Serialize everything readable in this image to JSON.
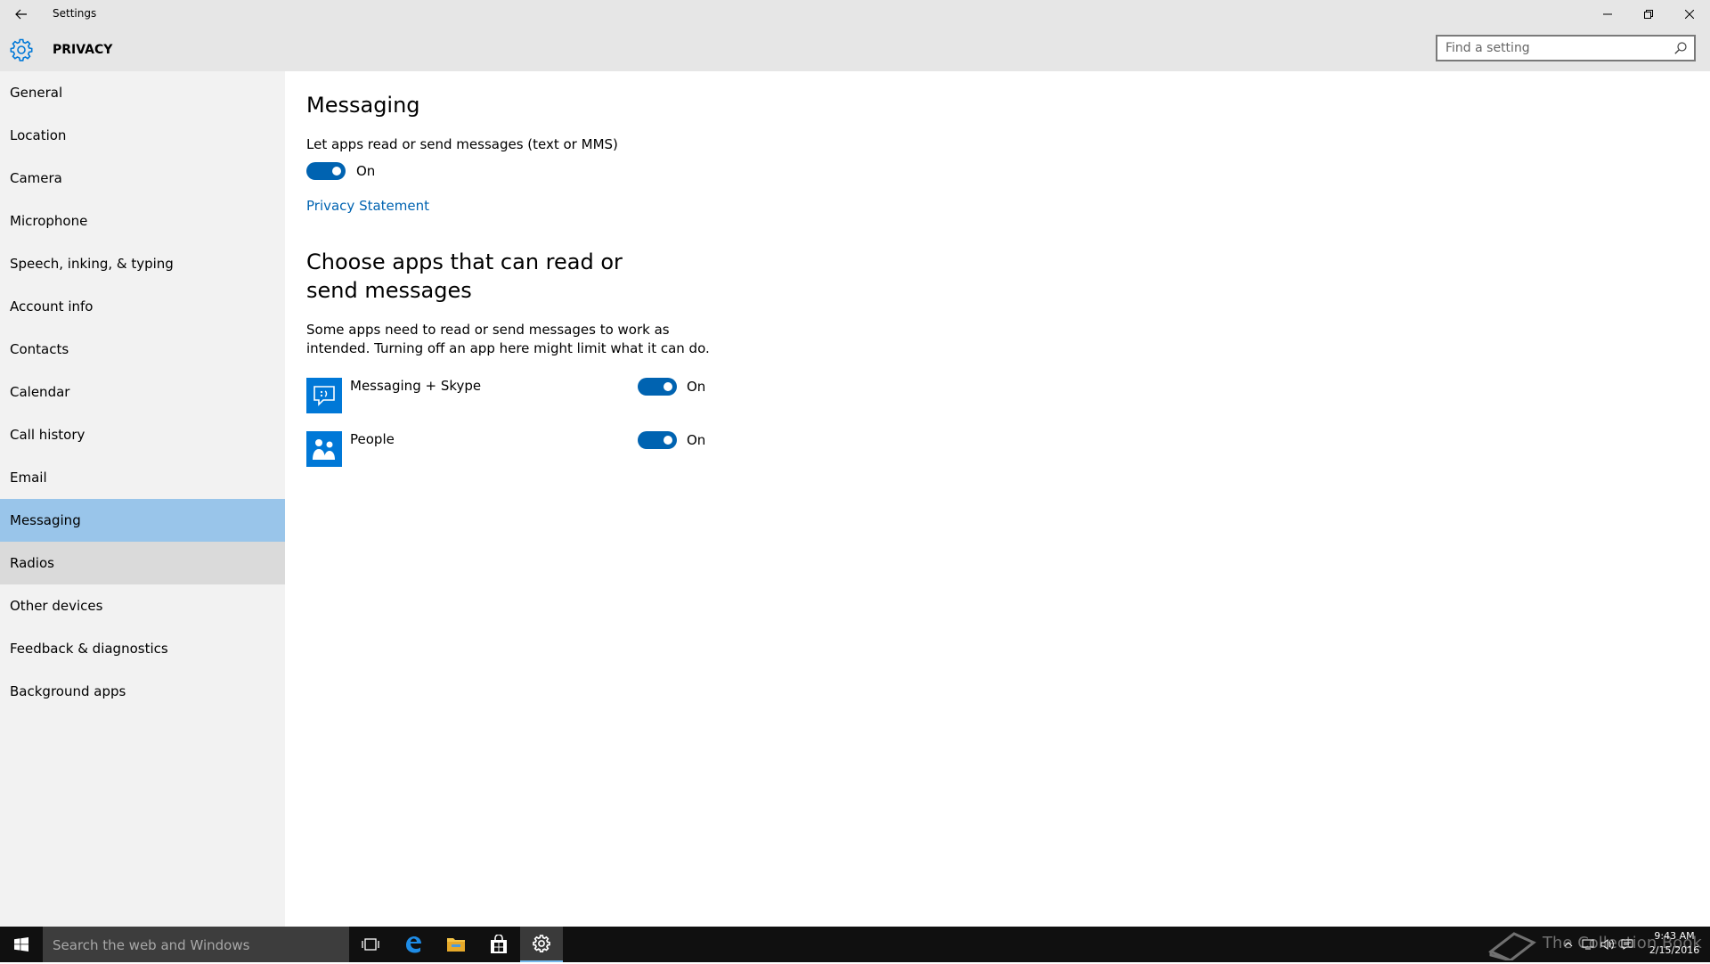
{
  "window": {
    "title": "Settings",
    "icons": {
      "back": "back-arrow-icon",
      "minimize": "minimize-icon",
      "restore": "restore-icon",
      "close": "close-icon"
    }
  },
  "header": {
    "section_title": "PRIVACY",
    "icon": "gear-icon",
    "search": {
      "placeholder": "Find a setting",
      "value": "",
      "icon": "search-icon"
    }
  },
  "sidebar": {
    "selected": "Messaging",
    "hovered": "Radios",
    "selected_color": "#99c5ea",
    "items": [
      {
        "label": "General"
      },
      {
        "label": "Location"
      },
      {
        "label": "Camera"
      },
      {
        "label": "Microphone"
      },
      {
        "label": "Speech, inking, & typing"
      },
      {
        "label": "Account info"
      },
      {
        "label": "Contacts"
      },
      {
        "label": "Calendar"
      },
      {
        "label": "Call history"
      },
      {
        "label": "Email"
      },
      {
        "label": "Messaging"
      },
      {
        "label": "Radios"
      },
      {
        "label": "Other devices"
      },
      {
        "label": "Feedback & diagnostics"
      },
      {
        "label": "Background apps"
      }
    ]
  },
  "main": {
    "title": "Messaging",
    "master_setting": {
      "label": "Let apps read or send messages (text or MMS)",
      "state": "On",
      "enabled": true
    },
    "privacy_link": "Privacy Statement",
    "apps_heading": "Choose apps that can read or send messages",
    "apps_description": "Some apps need to read or send messages to work as intended. Turning off an app here might limit what it can do.",
    "apps": [
      {
        "name": "Messaging + Skype",
        "icon": "messaging-skype-icon",
        "state": "On",
        "enabled": true
      },
      {
        "name": "People",
        "icon": "people-icon",
        "state": "On",
        "enabled": true
      }
    ],
    "accent_color": "#0063b1"
  },
  "taskbar": {
    "search_placeholder": "Search the web and Windows",
    "pinned": [
      {
        "name": "Task View",
        "icon": "task-view-icon"
      },
      {
        "name": "Microsoft Edge",
        "icon": "edge-icon"
      },
      {
        "name": "File Explorer",
        "icon": "file-explorer-icon"
      },
      {
        "name": "Store",
        "icon": "store-icon"
      },
      {
        "name": "Settings",
        "icon": "settings-icon",
        "active": true
      }
    ],
    "watermark": "The Collection Book",
    "tray_icons": [
      "chevron-up-icon",
      "network-icon",
      "volume-icon",
      "action-center-icon"
    ],
    "clock": {
      "time": "9:43 AM",
      "date": "2/15/2016"
    }
  }
}
